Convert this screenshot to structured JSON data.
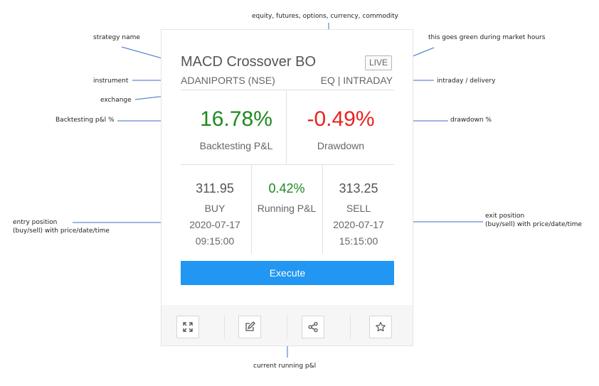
{
  "card": {
    "strategy_name": "MACD Crossover BO",
    "status_badge": "LIVE",
    "instrument": "ADANIPORTS (NSE)",
    "segment": "EQ | INTRADAY",
    "backtesting_pnl": {
      "value": "16.78%",
      "label": "Backtesting P&L",
      "color": "#1e8a1e"
    },
    "drawdown": {
      "value": "-0.49%",
      "label": "Drawdown",
      "color": "#e8231f"
    },
    "entry": {
      "price": "311.95",
      "side": "BUY",
      "date": "2020-07-17",
      "time": "09:15:00"
    },
    "running": {
      "value": "0.42%",
      "label": "Running P&L",
      "color": "#1e8a1e"
    },
    "exit": {
      "price": "313.25",
      "side": "SELL",
      "date": "2020-07-17",
      "time": "15:15:00"
    },
    "execute_label": "Execute",
    "execute_color": "#2196f3",
    "footer_icons": [
      "expand-icon",
      "edit-icon",
      "share-icon",
      "star-icon"
    ]
  },
  "annotations": {
    "segment_types": "equity, futures, options, currency, commodity",
    "strategy_name": "strategy name",
    "live_status": "this goes green during market hours",
    "instrument": "instrument",
    "intraday_delivery": "intraday / delivery",
    "exchange": "exchange",
    "backtesting_pnl": "Backtesting p&l %",
    "drawdown": "drawdown %",
    "entry_position": "entry position\n(buy/sell) with price/date/time",
    "exit_position": "exit position\n(buy/sell) with price/date/time",
    "current_running_pnl": "current running p&l"
  }
}
